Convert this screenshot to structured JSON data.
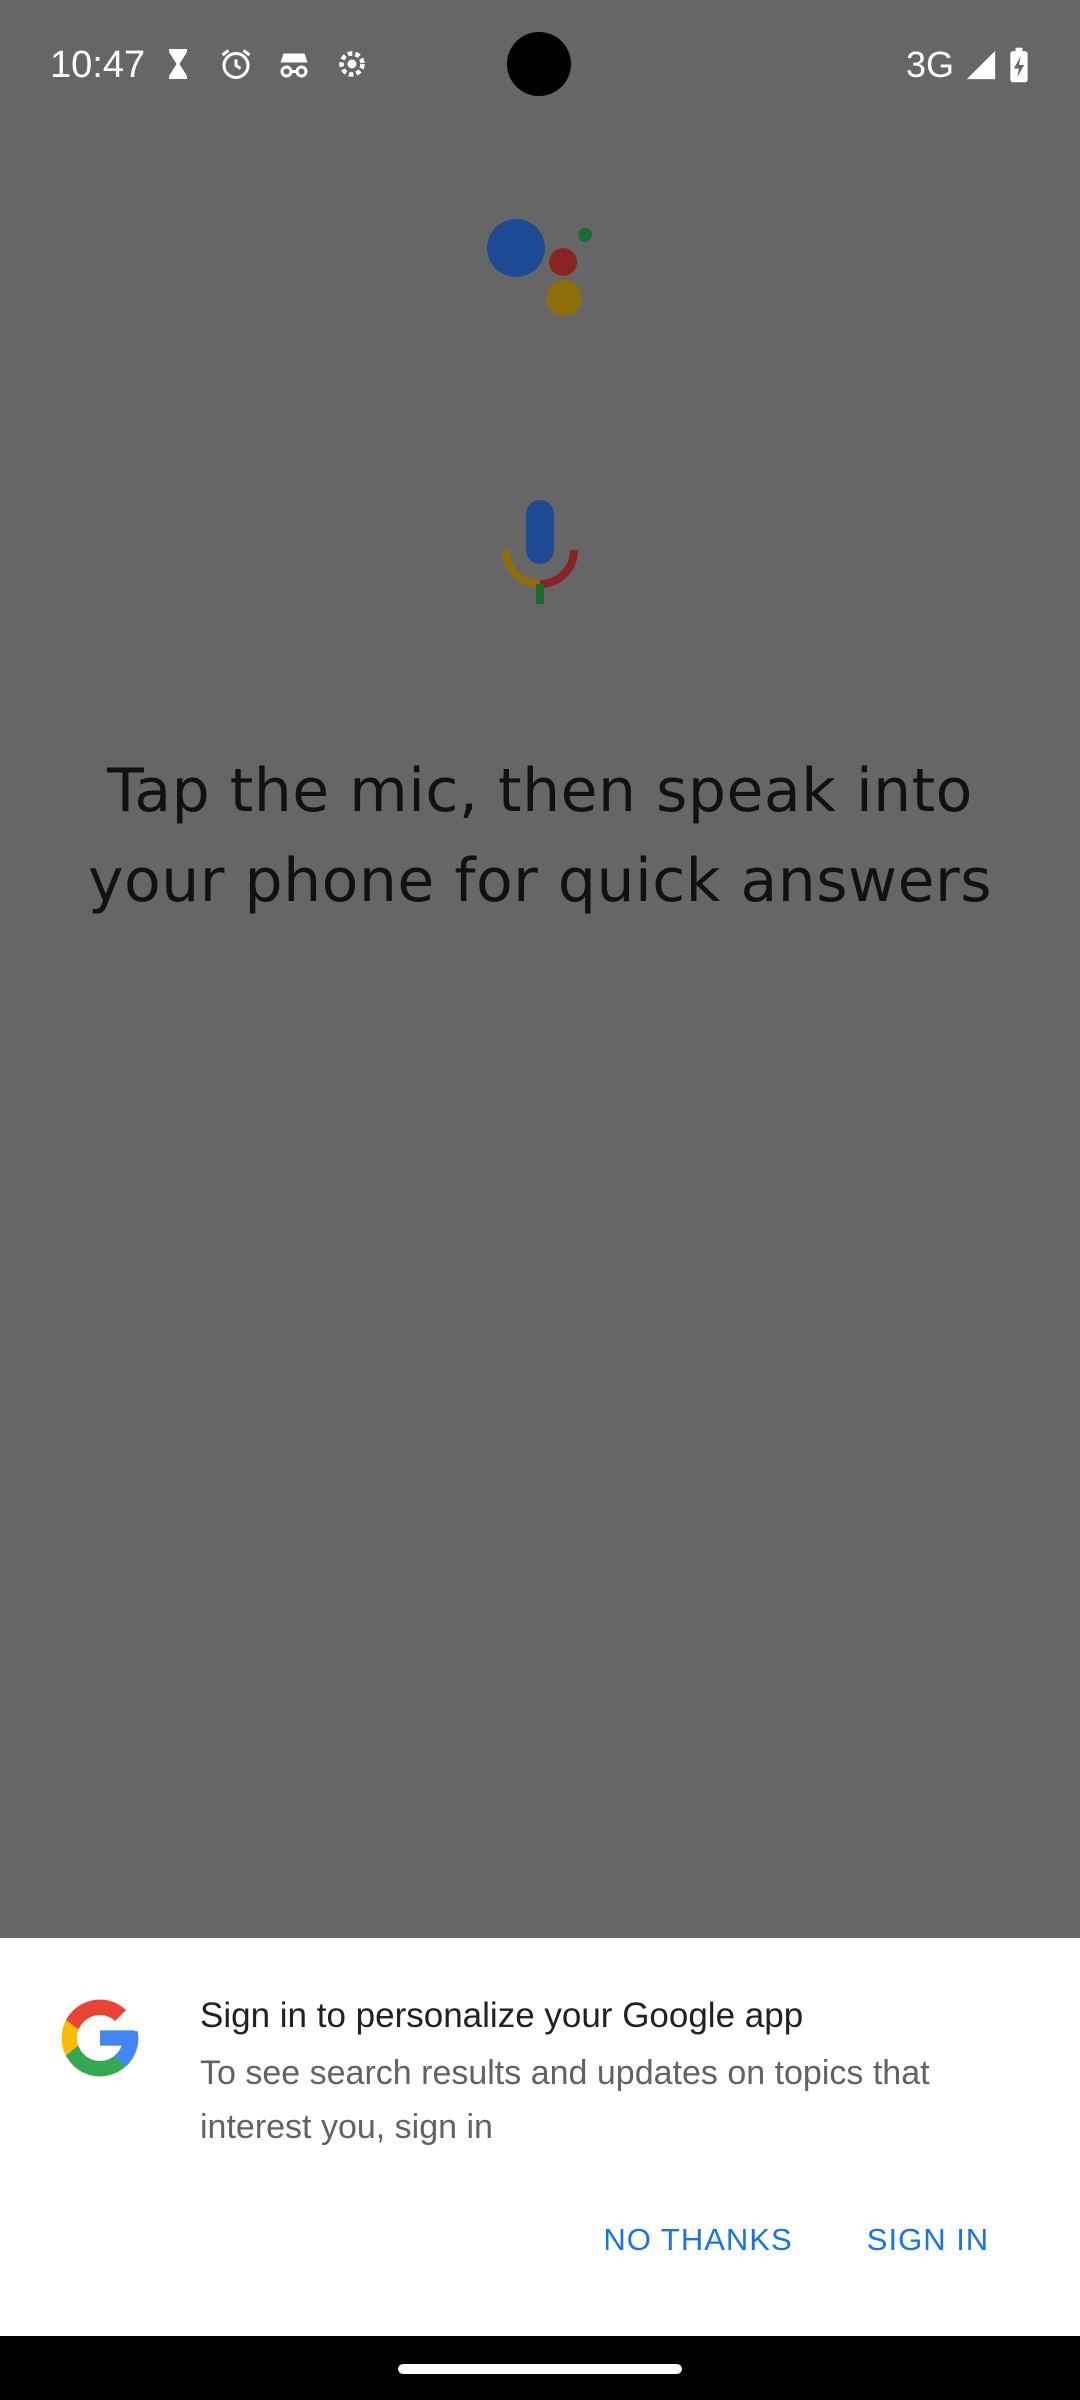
{
  "status_bar": {
    "time": "10:47",
    "network": "3G",
    "icons": [
      "hourglass-icon",
      "alarm-icon",
      "incognito-icon",
      "settings-gear-icon",
      "signal-icon",
      "battery-charging-icon"
    ]
  },
  "main": {
    "headline": "Tap the mic, then speak into your phone for quick answers",
    "assistant_logo": "google-assistant-dots-icon",
    "mic_icon": "microphone-icon"
  },
  "sign_in_sheet": {
    "title": "Sign in to personalize your Google app",
    "body": "To see search results and updates on topics that interest you, sign in",
    "no_thanks_label": "NO THANKS",
    "sign_in_label": "SIGN IN",
    "logo": "google-g-icon"
  },
  "colors": {
    "overlay": "#666666",
    "accent_blue": "#1a73e8",
    "google_blue": "#4285F4",
    "google_red": "#EA4335",
    "google_yellow": "#FBBC05",
    "google_green": "#34A853"
  }
}
